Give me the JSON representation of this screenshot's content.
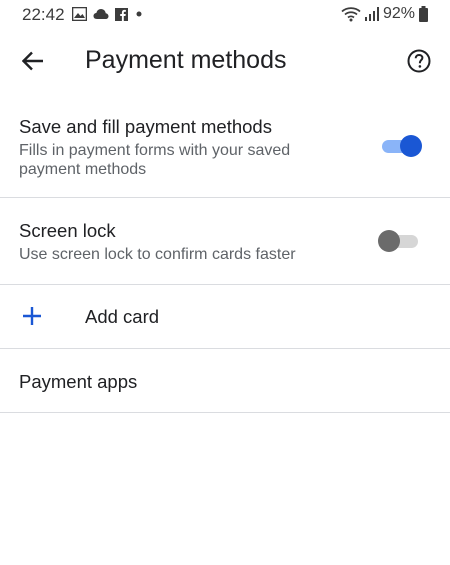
{
  "status_bar": {
    "time": "22:42",
    "left_icons": [
      "gallery-icon",
      "cloud-icon",
      "facebook-icon",
      "dot-icon"
    ],
    "right_icons": [
      "wifi-icon",
      "signal-icon",
      "battery-icon"
    ],
    "battery_percent": "92%"
  },
  "app_bar": {
    "title": "Payment methods",
    "back_icon": "arrow-back-icon",
    "help_icon": "help-circle-icon"
  },
  "settings": {
    "save_fill": {
      "title": "Save and fill payment methods",
      "subtitle": "Fills in payment forms with your saved payment methods",
      "enabled": true
    },
    "screen_lock": {
      "title": "Screen lock",
      "subtitle": "Use screen lock to confirm cards faster",
      "enabled": false
    },
    "add_card": {
      "label": "Add card",
      "icon": "plus-icon"
    },
    "payment_apps": {
      "title": "Payment apps"
    }
  },
  "colors": {
    "accent": "#1a57d4",
    "accent_track": "#8ab4f8",
    "divider": "#dadce0",
    "text_primary": "#202124",
    "text_secondary": "#5f6368"
  }
}
